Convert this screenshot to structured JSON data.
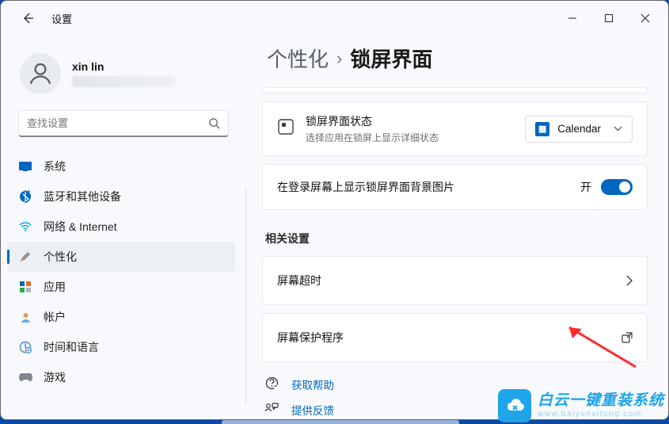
{
  "window": {
    "title": "设置"
  },
  "profile": {
    "name": "xin lin"
  },
  "search": {
    "placeholder": "查找设置"
  },
  "sidebar": {
    "items": [
      {
        "label": "系统"
      },
      {
        "label": "蓝牙和其他设备"
      },
      {
        "label": "网络 & Internet"
      },
      {
        "label": "个性化"
      },
      {
        "label": "应用"
      },
      {
        "label": "帐户"
      },
      {
        "label": "时间和语言"
      },
      {
        "label": "游戏"
      }
    ]
  },
  "breadcrumb": {
    "parent": "个性化",
    "sep": "›",
    "current": "锁屏界面"
  },
  "lockStatus": {
    "title": "锁屏界面状态",
    "subtitle": "选择应用在锁屏上显示详细状态",
    "selected": "Calendar"
  },
  "bgToggle": {
    "label": "在登录屏幕上显示锁屏界面背景图片",
    "state": "开"
  },
  "related": {
    "heading": "相关设置",
    "items": [
      {
        "label": "屏幕超时"
      },
      {
        "label": "屏幕保护程序"
      }
    ]
  },
  "help": {
    "get": "获取帮助",
    "feedback": "提供反馈"
  },
  "watermark": {
    "main": "白云一键重装系统",
    "sub": "www.baiyunxitong.com"
  }
}
